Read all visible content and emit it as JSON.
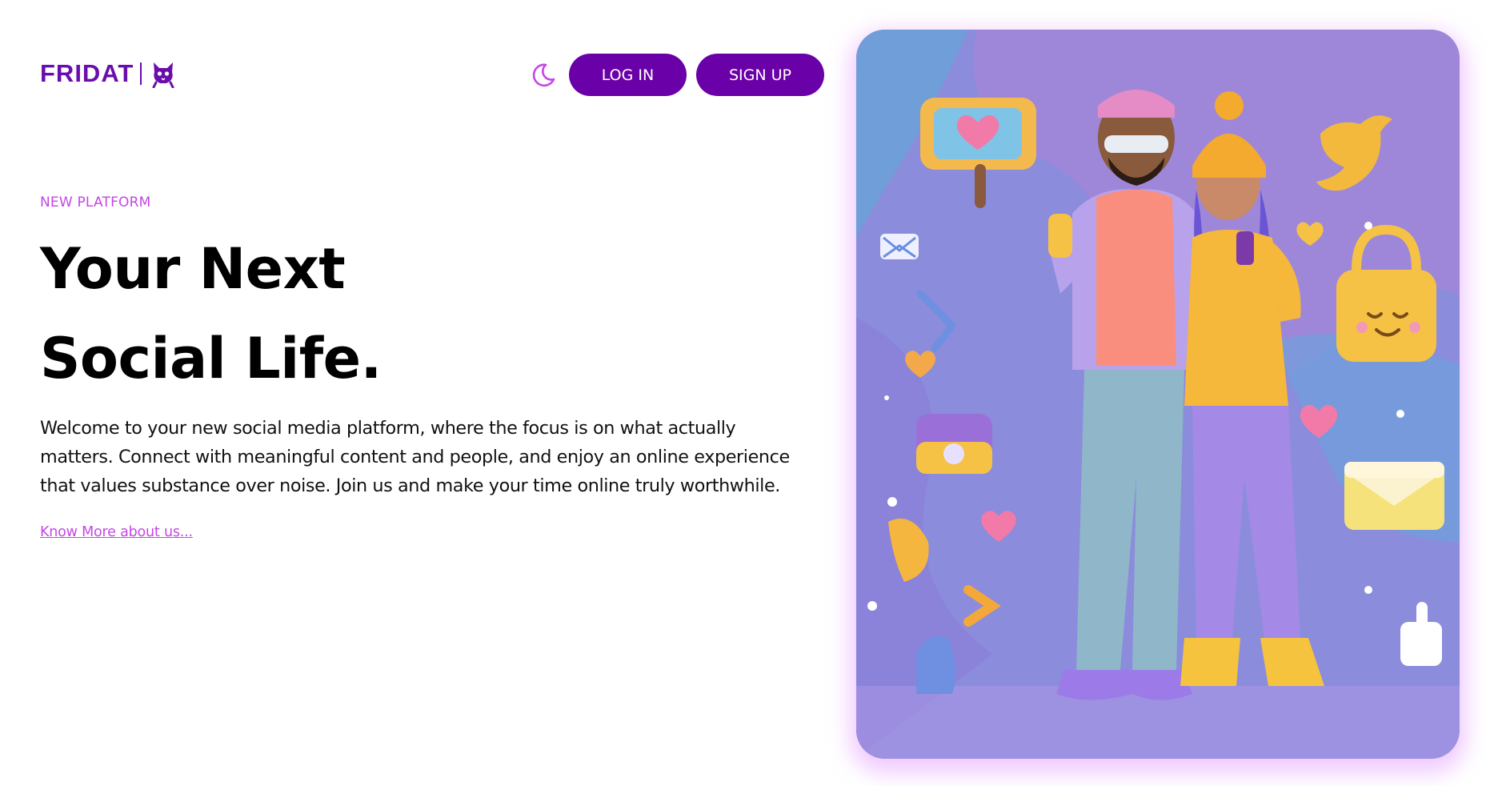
{
  "header": {
    "logo_text": "FRIDAT",
    "logo_icon": "cat-mascot-icon",
    "theme_toggle_icon": "moon-icon",
    "login_label": "LOG IN",
    "signup_label": "SIGN UP"
  },
  "hero": {
    "eyebrow": "NEW PLATFORM",
    "headline_line1": "Your Next",
    "headline_line2": "Social Life.",
    "description": "Welcome to your new social media platform, where the focus is on what actually matters. Connect with meaningful content and people, and enjoy an online experience that values substance over noise. Join us and make your time online truly worthwhile.",
    "know_more_link": "Know More about us..."
  },
  "colors": {
    "brand_purple": "#6a00a8",
    "accent_pink": "#c546e6",
    "hero_glow": "#e4a0ff"
  }
}
